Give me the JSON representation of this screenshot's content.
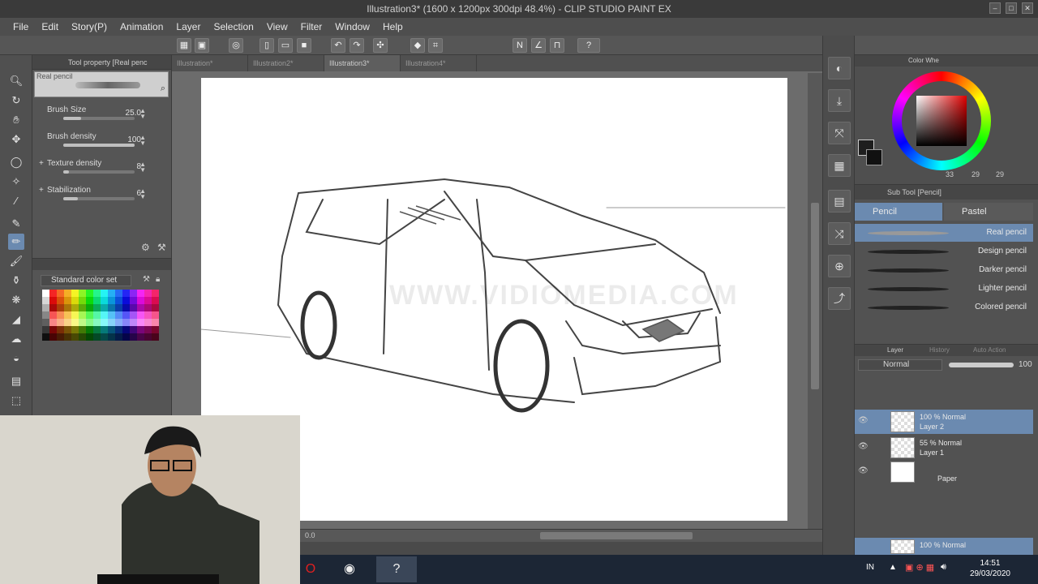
{
  "title": "Illustration3* (1600 x 1200px 300dpi 48.4%) - CLIP STUDIO PAINT EX",
  "menu": [
    "File",
    "Edit",
    "Story(P)",
    "Animation",
    "Layer",
    "Selection",
    "View",
    "Filter",
    "Window",
    "Help"
  ],
  "doc_tabs": [
    "Illustration*",
    "Illustration2*",
    "Illustration3*",
    "Illustration4*"
  ],
  "tool_property": {
    "tab": "Tool property [Real penc",
    "brush_name": "Real pencil",
    "rows": [
      {
        "label": "Brush Size",
        "value": "25.0",
        "level": 0.25
      },
      {
        "label": "Brush density",
        "value": "100",
        "level": 1.0
      },
      {
        "label": "Texture density",
        "value": "8",
        "level": 0.08
      },
      {
        "label": "Stabilization",
        "value": "6",
        "level": 0.2
      }
    ]
  },
  "color_set": {
    "name": "Standard color set"
  },
  "watermark": "WWW.VIDIOMEDIA.COM",
  "color_wheel": {
    "tab": "Color Whe",
    "values": [
      "33",
      "29",
      "29"
    ],
    "main_color": "#1e1e1e"
  },
  "sub_tool": {
    "tab": "Sub Tool [Pencil]",
    "tabs": [
      "Pencil",
      "Pastel"
    ],
    "brushes": [
      "Real pencil",
      "Design pencil",
      "Darker pencil",
      "Lighter pencil",
      "Colored pencil"
    ]
  },
  "layers": {
    "tabs": [
      "Layer",
      "History",
      "Auto Action"
    ],
    "blend": "Normal",
    "opacity": "100",
    "items": [
      {
        "mode": "100 % Normal",
        "name": "Layer 2"
      },
      {
        "mode": "55 % Normal",
        "name": "Layer 1"
      },
      {
        "mode": "",
        "name": "Paper"
      }
    ],
    "bottom_mode": "100 % Normal"
  },
  "taskbar": {
    "lang": "IN",
    "time": "14:51",
    "date": "29/03/2020"
  },
  "zoom_readout": "0.0",
  "accent": "#6b8ab0"
}
